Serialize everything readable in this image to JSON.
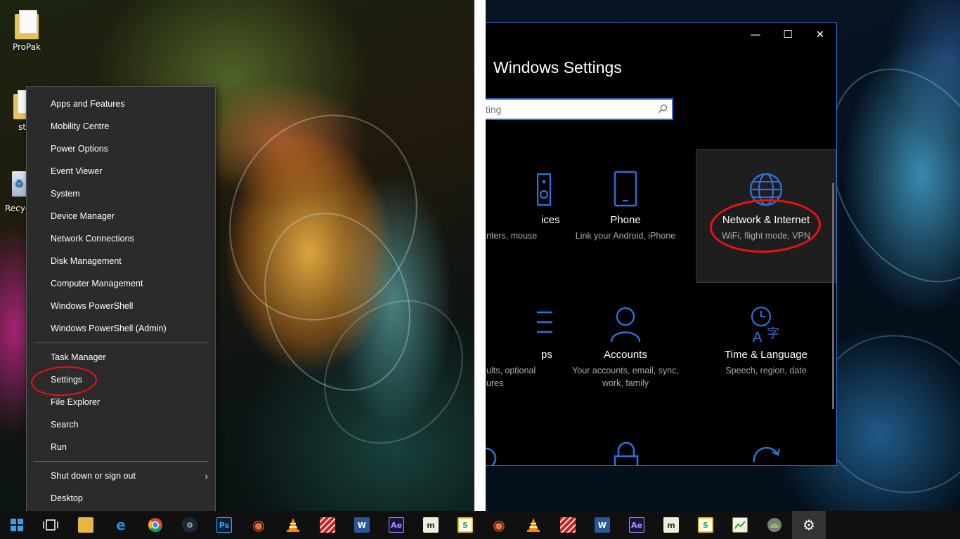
{
  "desktop": {
    "icons": [
      {
        "label": "ProPak"
      },
      {
        "label": "st"
      },
      {
        "label": "Recyc"
      }
    ]
  },
  "context_menu": {
    "group1": [
      "Apps and Features",
      "Mobility Centre",
      "Power Options",
      "Event Viewer",
      "System",
      "Device Manager",
      "Network Connections",
      "Disk Management",
      "Computer Management",
      "Windows PowerShell",
      "Windows PowerShell (Admin)"
    ],
    "group2": [
      "Task Manager",
      "Settings",
      "File Explorer",
      "Search",
      "Run"
    ],
    "group3": [
      "Shut down or sign out",
      "Desktop"
    ],
    "highlight_color": "#ee1111"
  },
  "settings_window": {
    "title": "Windows Settings",
    "search_placeholder": "tting",
    "controls": {
      "minimize": "—",
      "maximize": "☐",
      "close": "✕"
    },
    "accent": "#2f6fd8",
    "tiles": [
      {
        "title": "ices",
        "sub": "nters, mouse",
        "icon": "devices-icon"
      },
      {
        "title": "Phone",
        "sub": "Link your Android, iPhone",
        "icon": "phone-icon"
      },
      {
        "title": "Network & Internet",
        "sub": "WiFi, flight mode, VPN",
        "icon": "globe-icon",
        "selected": true
      },
      {
        "title": "ps",
        "sub": "ults, optional",
        "sub2": "ures",
        "icon": "apps-icon"
      },
      {
        "title": "Accounts",
        "sub": "Your accounts, email, sync,",
        "sub2": "work, family",
        "icon": "person-icon"
      },
      {
        "title": "Time & Language",
        "sub": "Speech, region, date",
        "icon": "time-language-icon"
      }
    ]
  },
  "taskbar": {
    "items": [
      {
        "name": "start-button",
        "icon": "windows-logo-icon"
      },
      {
        "name": "task-view-button",
        "icon": "task-view-icon"
      },
      {
        "name": "file-explorer-taskbar",
        "icon": "folder-icon"
      },
      {
        "name": "edge-taskbar",
        "icon": "edge-icon"
      },
      {
        "name": "chrome-taskbar",
        "icon": "chrome-icon"
      },
      {
        "name": "steam-taskbar",
        "icon": "steam-icon"
      },
      {
        "name": "photoshop-taskbar",
        "icon": "photoshop-icon",
        "text": "Ps"
      },
      {
        "name": "origin-taskbar",
        "icon": "origin-icon"
      },
      {
        "name": "vlc-taskbar",
        "icon": "vlc-icon"
      },
      {
        "name": "striped-app-taskbar",
        "icon": "striped-app-icon"
      },
      {
        "name": "word-taskbar",
        "icon": "word-icon",
        "text": "W"
      },
      {
        "name": "after-effects-taskbar",
        "icon": "after-effects-icon",
        "text": "Ae"
      },
      {
        "name": "mu-app-taskbar",
        "icon": "mu-icon",
        "text": "m"
      },
      {
        "name": "s-app-taskbar",
        "icon": "s-app-icon",
        "text": "S"
      },
      {
        "name": "origin-taskbar-2",
        "icon": "origin-icon"
      },
      {
        "name": "vlc-taskbar-2",
        "icon": "vlc-icon"
      },
      {
        "name": "striped-app-taskbar-2",
        "icon": "striped-app-icon"
      },
      {
        "name": "word-taskbar-2",
        "icon": "word-icon",
        "text": "W"
      },
      {
        "name": "after-effects-taskbar-2",
        "icon": "after-effects-icon",
        "text": "Ae"
      },
      {
        "name": "mu-app-taskbar-2",
        "icon": "mu-icon",
        "text": "m"
      },
      {
        "name": "s-app-taskbar-2",
        "icon": "s-app-icon",
        "text": "S"
      },
      {
        "name": "notepad-app-taskbar",
        "icon": "notepad-icon"
      },
      {
        "name": "android-app-taskbar",
        "icon": "android-icon"
      },
      {
        "name": "settings-taskbar",
        "icon": "gear-icon",
        "active": true
      }
    ]
  }
}
